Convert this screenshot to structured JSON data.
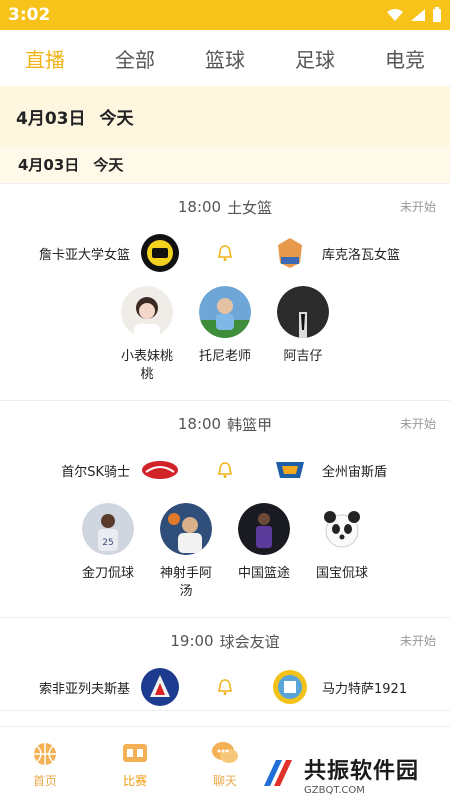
{
  "status_bar": {
    "time": "3:02"
  },
  "tabs": [
    {
      "label": "直播"
    },
    {
      "label": "全部"
    },
    {
      "label": "篮球"
    },
    {
      "label": "足球"
    },
    {
      "label": "电竞"
    }
  ],
  "date_header_main": {
    "date": "4月03日",
    "day": "今天"
  },
  "date_header_sub": {
    "date": "4月03日",
    "day": "今天"
  },
  "matches": [
    {
      "time": "18:00",
      "league": "土女篮",
      "status": "未开始",
      "home": "詹卡亚大学女篮",
      "away": "库克洛瓦女篮",
      "anchors": [
        "小表妹桃桃",
        "托尼老师",
        "阿吉仔"
      ]
    },
    {
      "time": "18:00",
      "league": "韩篮甲",
      "status": "未开始",
      "home": "首尔SK骑士",
      "away": "全州宙斯盾",
      "anchors": [
        "金刀侃球",
        "神射手阿汤",
        "中国篮途",
        "国宝侃球"
      ]
    },
    {
      "time": "19:00",
      "league": "球会友谊",
      "status": "未开始",
      "home": "索非亚列夫斯基",
      "away": "马力特萨1921",
      "anchors": []
    }
  ],
  "bottom_nav": [
    {
      "label": "首页"
    },
    {
      "label": "比赛"
    },
    {
      "label": "聊天"
    },
    {
      "label": ""
    },
    {
      "label": ""
    }
  ],
  "watermark": {
    "name": "共振软件园",
    "url": "GZBQT.COM"
  },
  "colors": {
    "accent": "#f7c21a",
    "tab_active": "#f1b317",
    "nav": "#e8a94a"
  }
}
